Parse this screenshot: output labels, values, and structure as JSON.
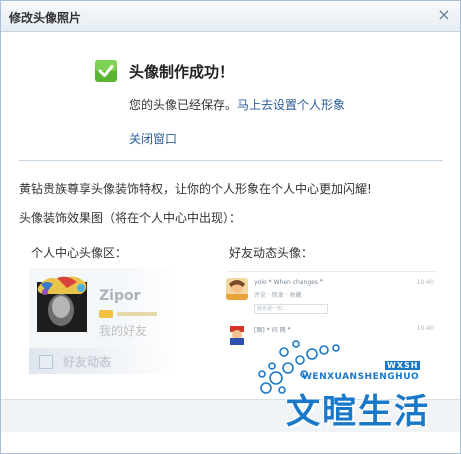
{
  "dialog": {
    "title": "修改头像照片",
    "close_glyph": "×"
  },
  "result": {
    "success_title": "头像制作成功！",
    "saved_text": "您的头像已经保存。",
    "setup_link": "马上去设置个人形象",
    "close_window": "关闭窗口"
  },
  "promo": {
    "text": "黄钻贵族尊享头像装饰特权，让你的个人形象在个人中心更加闪耀!",
    "effect_label": "头像装饰效果图（将在个人中心中出现）："
  },
  "previews": {
    "center_label": "个人中心头像区：",
    "friend_label": "好友动态头像：",
    "card": {
      "name": "Zipor",
      "subtitle": "我的好友",
      "footer": "好友动态"
    },
    "feed": [
      {
        "text": "yolo ❝ When changes ❞",
        "sub": "评论 · 转发 · 收藏",
        "time": "10:40"
      },
      {
        "text": "[图] ❝ 问 网 ❞",
        "sub": "我也说一句...",
        "time": "10:40"
      }
    ]
  },
  "watermark": {
    "tag": "WXSH",
    "latin": "WENXUANSHENGHUO",
    "cn": "文暄生活"
  },
  "colors": {
    "link": "#2b5d9a",
    "check_green": "#5cb531",
    "watermark_blue": "#1a78c8"
  }
}
